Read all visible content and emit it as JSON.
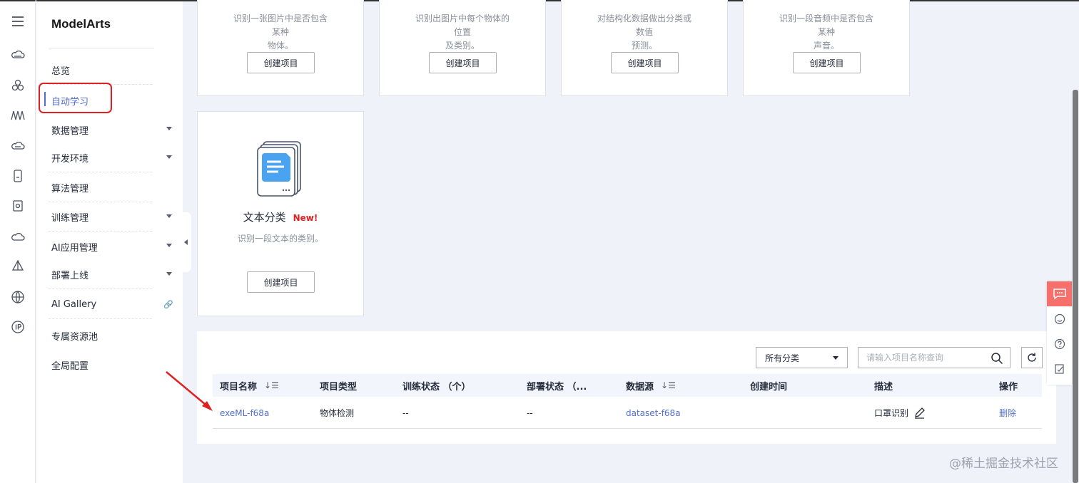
{
  "app_title": "ModelArts",
  "sidebar": {
    "items": [
      {
        "label": "总览"
      },
      {
        "label": "自动学习"
      },
      {
        "label": "数据管理"
      },
      {
        "label": "开发环境"
      },
      {
        "label": "算法管理"
      },
      {
        "label": "训练管理"
      },
      {
        "label": "AI应用管理"
      },
      {
        "label": "部署上线"
      },
      {
        "label": "AI Gallery"
      },
      {
        "label": "专属资源池"
      },
      {
        "label": "全局配置"
      }
    ]
  },
  "cards": [
    {
      "desc_line1": "识别一张图片中是否包含某种",
      "desc_line2": "物体。",
      "button": "创建项目"
    },
    {
      "desc_line1": "识别出图片中每个物体的位置",
      "desc_line2": "及类别。",
      "button": "创建项目"
    },
    {
      "desc_line1": "对结构化数据做出分类或数值",
      "desc_line2": "预测。",
      "button": "创建项目"
    },
    {
      "desc_line1": "识别一段音频中是否包含某种",
      "desc_line2": "声音。",
      "button": "创建项目"
    },
    {
      "title": "文本分类",
      "badge": "New!",
      "desc_line1": "识别一段文本的类别。",
      "button": "创建项目"
    }
  ],
  "toolbar": {
    "category_select": "所有分类",
    "search_placeholder": "请输入项目名称查询"
  },
  "table": {
    "columns": [
      "项目名称",
      "项目类型",
      "训练状态 （个）",
      "部署状态 （...",
      "数据源",
      "创建时间",
      "描述",
      "操作"
    ],
    "rows": [
      {
        "name": "exeML-f68a",
        "type": "物体检测",
        "train_status": "--",
        "deploy_status": "--",
        "datasource": "dataset-f68a",
        "created": "",
        "desc": "口罩识别",
        "action": "删除"
      }
    ]
  },
  "watermark": "@稀土掘金技术社区",
  "colors": {
    "accent": "#526ecc",
    "highlight": "#e02020",
    "float_accent": "#f66f6a"
  }
}
